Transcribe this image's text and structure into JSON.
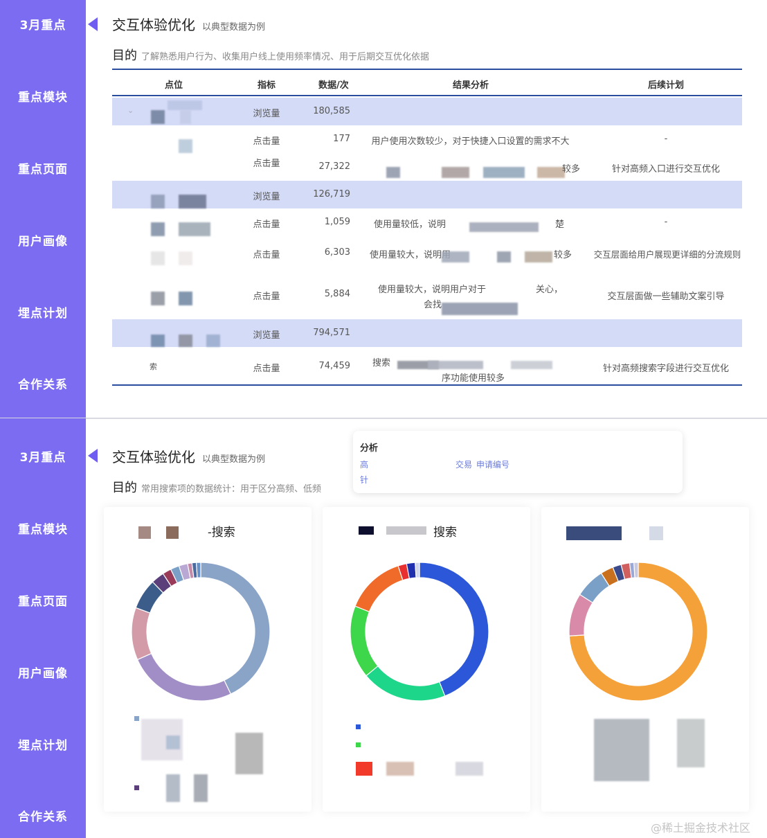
{
  "sidebar_panel_1": [
    "3月重点",
    "重点模块",
    "重点页面",
    "用户画像",
    "埋点计划",
    "合作关系"
  ],
  "sidebar_panel_2": [
    "3月重点",
    "重点模块",
    "重点页面",
    "用户画像",
    "埋点计划",
    "合作关系"
  ],
  "panel_1": {
    "title": "交互体验优化",
    "title_sub": "以典型数据为例",
    "goal_label": "目的",
    "goal_text": "了解熟悉用户行为、收集用户线上使用频率情况、用于后期交互优化依据"
  },
  "panel_2": {
    "title": "交互体验优化",
    "title_sub": "以典型数据为例",
    "goal_label": "目的",
    "goal_text": "常用搜索项的数据统计：用于区分高频、低频"
  },
  "table": {
    "headers": [
      "点位",
      "指标",
      "数据/次",
      "结果分析",
      "后续计划"
    ],
    "rows": [
      {
        "metric": "浏览量",
        "value": "180,585",
        "analysis": "",
        "plan": ""
      },
      {
        "metric": "点击量",
        "value": "177",
        "analysis": "用户使用次数较少，对于快捷入口设置的需求不大",
        "plan": "-"
      },
      {
        "metric": "点击量",
        "value": "27,322",
        "analysis": "较多",
        "plan": "针对高频入口进行交互优化"
      },
      {
        "metric": "浏览量",
        "value": "126,719",
        "analysis": "",
        "plan": ""
      },
      {
        "metric": "点击量",
        "value": "1,059",
        "analysis": "使用量较低，说明",
        "plan": "-"
      },
      {
        "metric": "点击量",
        "value": "6,303",
        "analysis": "使用量较大，说明用",
        "plan": "交互层面给用户展现更详细的分流规则"
      },
      {
        "metric": "点击量",
        "value": "5,884",
        "analysis": "使用量较大，说明用户对于",
        "plan": "交互层面做一些辅助文案引导"
      },
      {
        "metric": "浏览量",
        "value": "794,571",
        "analysis": "",
        "plan": ""
      },
      {
        "metric": "点击量",
        "value": "74,459",
        "analysis": "搜索",
        "plan": "针对高频搜索字段进行交互优化"
      }
    ],
    "extra_texts": {
      "row3_tail": "楚",
      "row5_tail": "较多",
      "row6_tail": "关心，",
      "row6_second": "会找",
      "row8_second": "序功能使用较多",
      "row8_point": "索"
    }
  },
  "tooltip": {
    "title": "分析",
    "line1_left": "高",
    "line1_mid": "交易",
    "line1_right": "申请编号",
    "line2": "针"
  },
  "charts_titles": [
    "-搜索",
    "搜索"
  ],
  "chart_data": [
    {
      "type": "pie",
      "title": "-搜索",
      "values": [
        42,
        25,
        12,
        7,
        3,
        2,
        2,
        2,
        1,
        1,
        1
      ],
      "colors": [
        "#8aa4c8",
        "#a28ec6",
        "#d39aa8",
        "#3c5d8a",
        "#5a3f7a",
        "#9a3b5a",
        "#7aa0c8",
        "#b9a8d4",
        "#c48aa8",
        "#4a6aa0",
        "#6a90c8"
      ]
    },
    {
      "type": "pie",
      "title": "搜索",
      "values": [
        44,
        20,
        17,
        14,
        2,
        2,
        1
      ],
      "colors": [
        "#2b57d8",
        "#1ed68a",
        "#3ed64a",
        "#f06a2a",
        "#e83030",
        "#1f2fae",
        "#cfd6ee"
      ]
    },
    {
      "type": "pie",
      "title": "",
      "values": [
        74,
        10,
        7,
        3,
        2,
        2,
        1,
        1
      ],
      "colors": [
        "#f5a13a",
        "#d98aa8",
        "#7aa0c8",
        "#c8701e",
        "#3a4a8a",
        "#d06060",
        "#9aa8d8",
        "#c8c8e0"
      ]
    }
  ],
  "watermark": "@稀土掘金技术社区"
}
